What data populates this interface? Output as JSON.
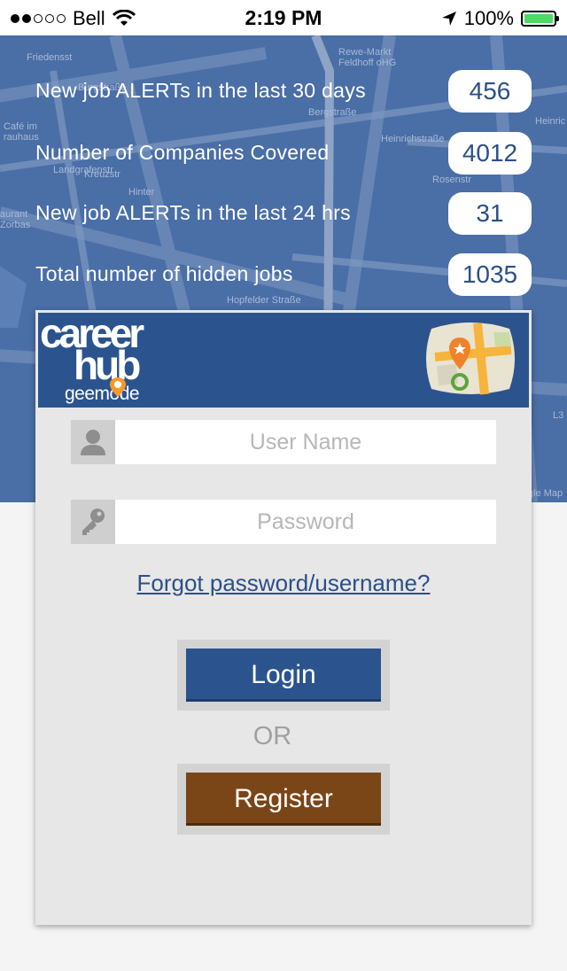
{
  "status_bar": {
    "carrier": "Bell",
    "time": "2:19 PM",
    "battery": "100%"
  },
  "map_labels": [
    "Friedensst",
    "Burgstraße",
    "Café im",
    "rauhaus",
    "aurant",
    "Zorbas",
    "Landgrafenstr",
    "Kreuzstr",
    "Hinter",
    "Bergstraße",
    "Rewe-Markt",
    "Feldhoff oHG",
    "Heinrichstraße",
    "Rosenstr",
    "Hopfelder Straße",
    "Heinric",
    "L3",
    "gle Map"
  ],
  "stats": [
    {
      "label": "New job ALERTs in the last 30 days",
      "value": "456"
    },
    {
      "label": "Number of Companies Covered",
      "value": "4012"
    },
    {
      "label": "New job ALERTs in the last 24 hrs",
      "value": "31"
    },
    {
      "label": "Total number of hidden jobs",
      "value": "1035"
    }
  ],
  "brand": {
    "line1": "career",
    "line2": "hub",
    "line3": "geemode"
  },
  "login_form": {
    "username_placeholder": "User Name",
    "password_placeholder": "Password",
    "forgot_link": "Forgot password/username?",
    "login_label": "Login",
    "or_text": "OR",
    "register_label": "Register"
  },
  "colors": {
    "brand_blue": "#2b548e",
    "register_brown": "#7a4517",
    "map_overlay": "#4a6ea6"
  }
}
